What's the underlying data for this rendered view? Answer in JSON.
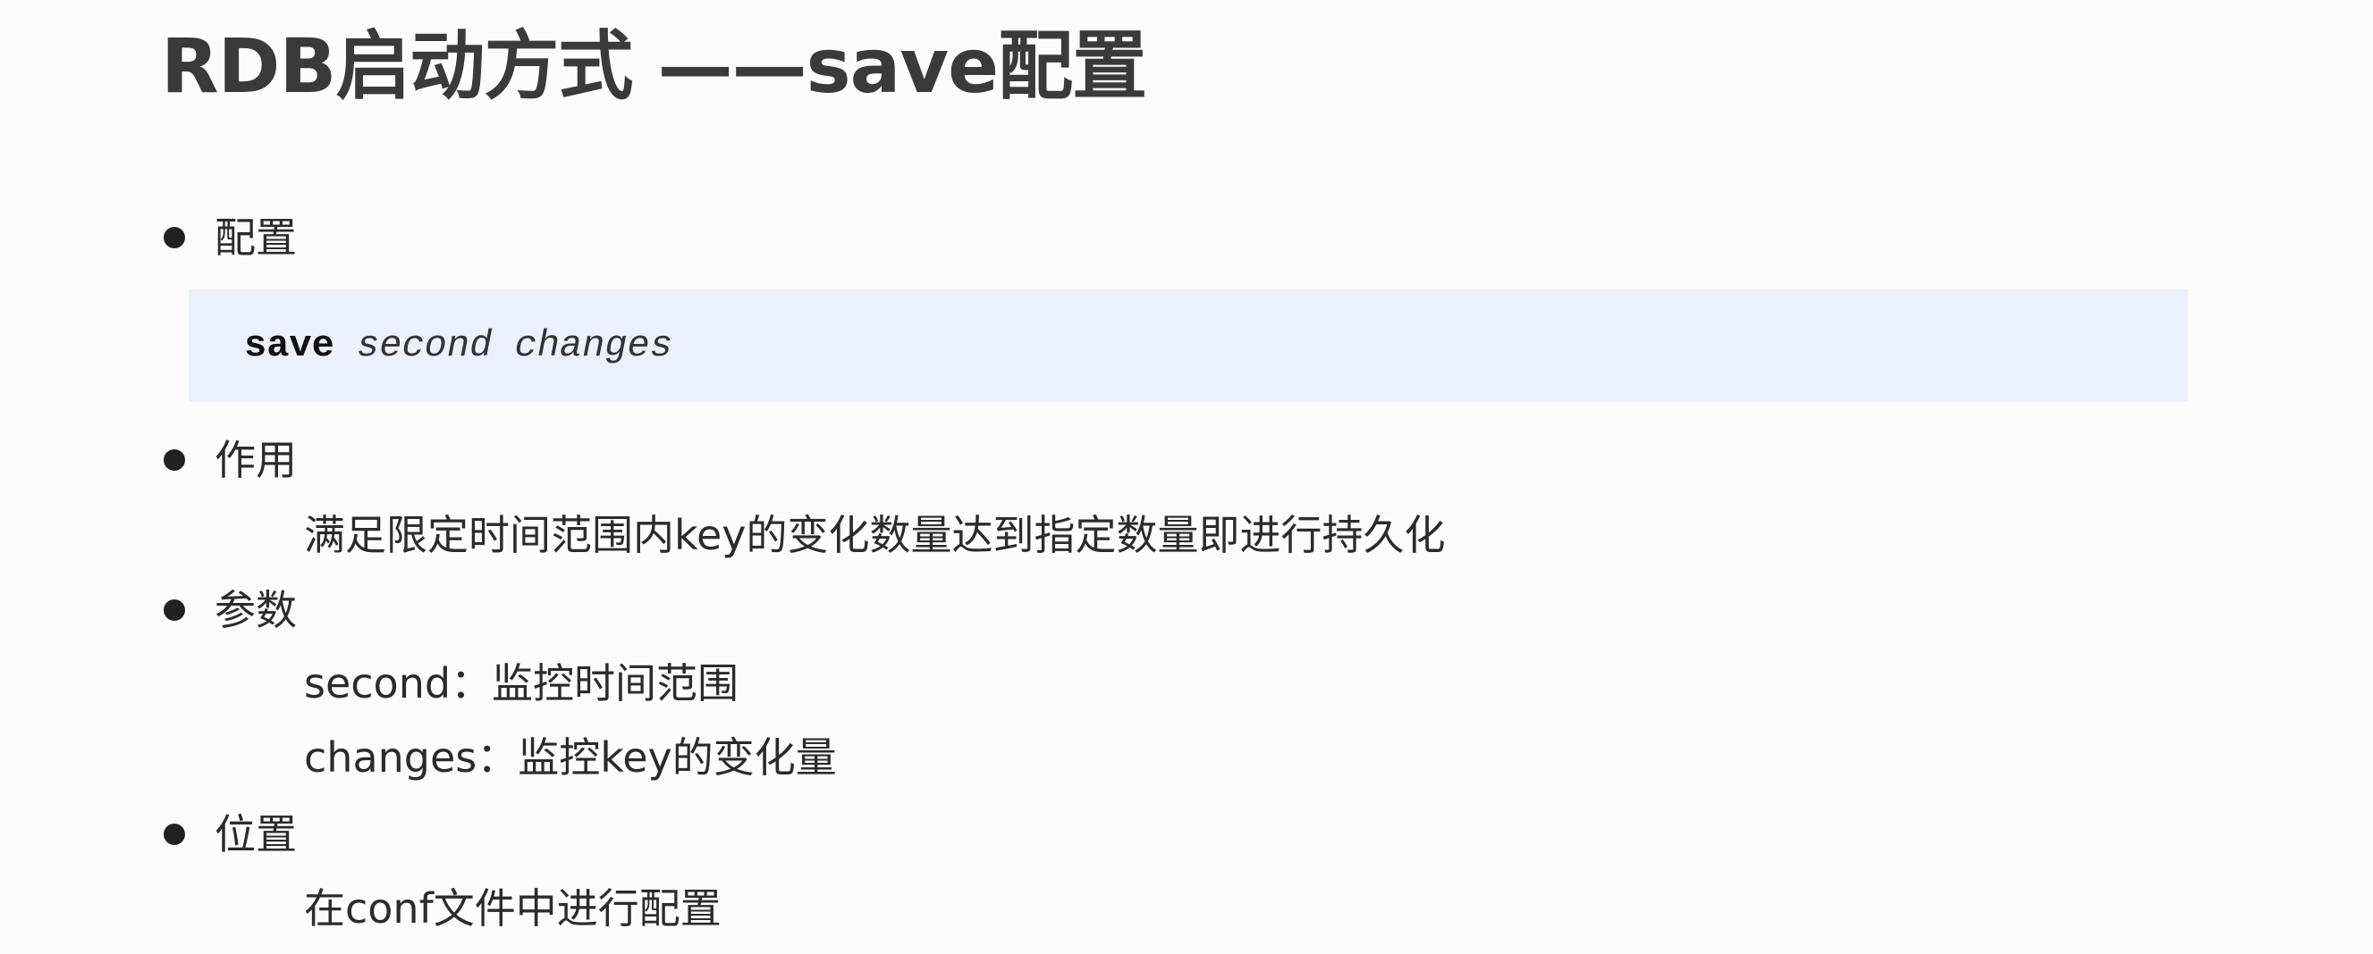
{
  "title": "RDB启动方式 ——save配置",
  "sections": [
    {
      "label": "配置",
      "code": {
        "keyword": "save",
        "params": [
          "second",
          "changes"
        ]
      }
    },
    {
      "label": "作用",
      "lines": [
        "满足限定时间范围内key的变化数量达到指定数量即进行持久化"
      ]
    },
    {
      "label": "参数",
      "lines": [
        "second：监控时间范围",
        "changes：监控key的变化量"
      ]
    },
    {
      "label": "位置",
      "lines": [
        "在conf文件中进行配置"
      ]
    }
  ]
}
